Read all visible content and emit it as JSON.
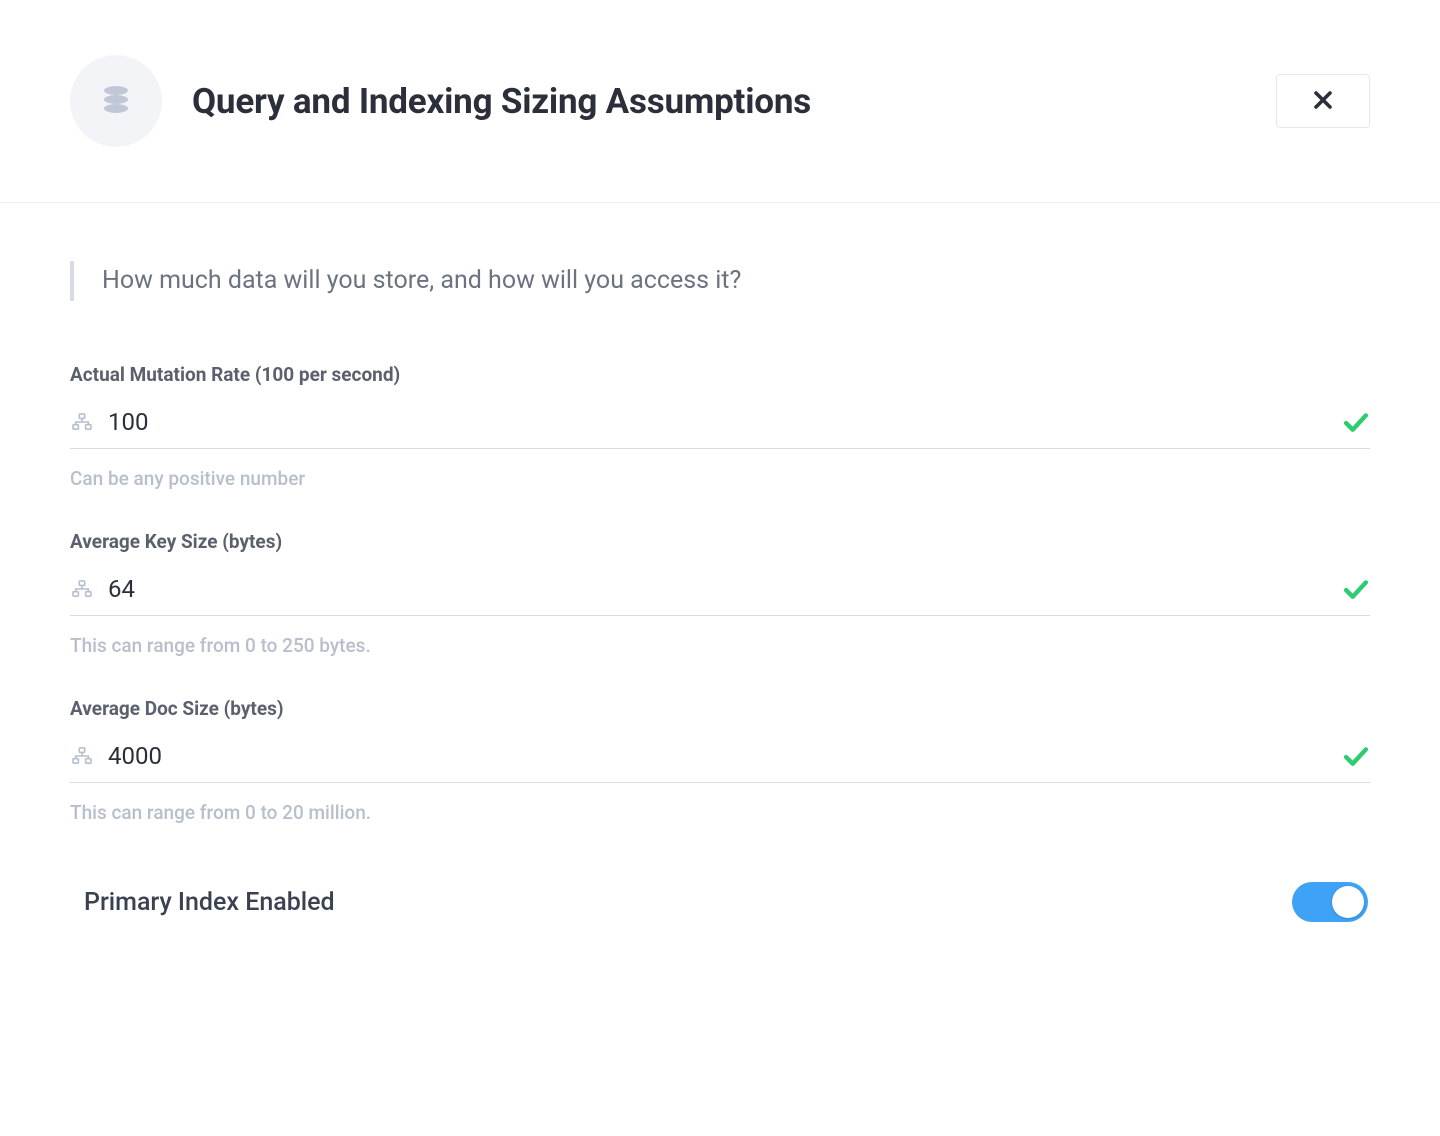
{
  "header": {
    "title": "Query and Indexing Sizing Assumptions"
  },
  "intro": {
    "text": "How much data will you store, and how will you access it?"
  },
  "fields": {
    "mutation_rate": {
      "label": "Actual Mutation Rate (100 per second)",
      "value": "100",
      "hint": "Can be any positive number"
    },
    "avg_key_size": {
      "label": "Average Key Size (bytes)",
      "value": "64",
      "hint": "This can range from 0 to 250 bytes."
    },
    "avg_doc_size": {
      "label": "Average Doc Size (bytes)",
      "value": "4000",
      "hint": "This can range from 0 to 20 million."
    }
  },
  "toggle": {
    "primary_index_label": "Primary Index Enabled",
    "primary_index_enabled": true
  }
}
